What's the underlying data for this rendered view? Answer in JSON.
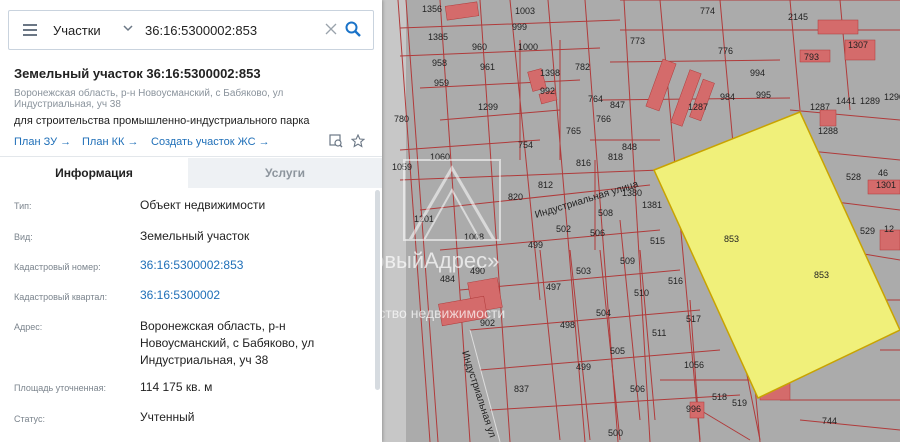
{
  "search": {
    "type_label": "Участки",
    "query": "36:16:5300002:853"
  },
  "card": {
    "title": "Земельный участок 36:16:5300002:853",
    "address_short": "Воронежская область, р-н Новоусманский, с Бабяково, ул Индустриальная, уч 38",
    "purpose": "для строительства промышленно-индустриального парка",
    "links": {
      "plan_zu": "План ЗУ →",
      "plan_kk": "План КК →",
      "create_zhs": "Создать участок ЖС →"
    }
  },
  "tabs": {
    "info": "Информация",
    "services": "Услуги"
  },
  "info": {
    "type_label": "Тип:",
    "type_value": "Объект недвижимости",
    "kind_label": "Вид:",
    "kind_value": "Земельный участок",
    "cad_num_label": "Кадастровый номер:",
    "cad_num_value": "36:16:5300002:853",
    "cad_block_label": "Кадастровый квартал:",
    "cad_block_value": "36:16:5300002",
    "address_label": "Адрес:",
    "address_value_l1": "Воронежская область, р-н",
    "address_value_l2": "Новоусманский, с Бабяково, ул",
    "address_value_l3": "Индустриальная, уч 38",
    "area_label": "Площадь уточненная:",
    "area_value": "114 175 кв. м",
    "status_label": "Статус:",
    "status_value": "Учтенный"
  },
  "map": {
    "street_1": "Индустриальная улица",
    "street_2": "Индустриальная ул",
    "watermark_1": "«НовыйАдрес»",
    "watermark_2": "агентство недвижимости",
    "highlight_label_1": "853",
    "highlight_label_2": "853",
    "plot_labels": [
      "1356",
      "1385",
      "958",
      "959",
      "960",
      "961",
      "999",
      "1000",
      "1003",
      "1398",
      "992",
      "782",
      "773",
      "774",
      "2145",
      "776",
      "793",
      "1307",
      "994",
      "995",
      "984",
      "764",
      "765",
      "766",
      "1299",
      "780",
      "847",
      "1287",
      "1441",
      "1289",
      "1290",
      "1288",
      "754",
      "816",
      "818",
      "848",
      "528",
      "46",
      "1301",
      "1059",
      "1060",
      "1201",
      "1008",
      "820",
      "812",
      "508",
      "1380",
      "1381",
      "529",
      "12",
      "1005",
      "490",
      "499",
      "502",
      "506",
      "509",
      "515",
      "484",
      "497",
      "503",
      "510",
      "516",
      "902",
      "498",
      "504",
      "511",
      "517",
      "499",
      "505",
      "1056",
      "837",
      "506",
      "518",
      "996",
      "519",
      "500",
      "744"
    ],
    "colors": {
      "background": "#aaaaaa",
      "plot_border": "#b03a3a",
      "highlight_fill": "#f0f07a",
      "highlight_border": "#c9a300",
      "building": "#d46b6b",
      "accent": "#1a73c8"
    }
  },
  "icons": [
    "menu-icon",
    "chevron-down-icon",
    "clear-icon",
    "search-icon",
    "collapse-panel-icon",
    "measure-icon",
    "star-icon"
  ]
}
